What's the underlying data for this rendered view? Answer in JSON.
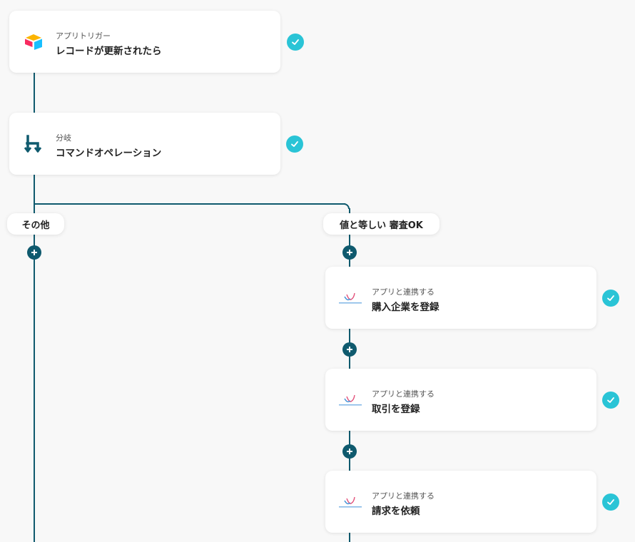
{
  "trigger": {
    "subtitle": "アプリトリガー",
    "title": "レコードが更新されたら",
    "icon": "airtable-logo-icon"
  },
  "branch_step": {
    "subtitle": "分岐",
    "title": "コマンドオペレーション",
    "icon": "branch-icon"
  },
  "branches": {
    "other_label": "その他",
    "match_label": "値と等しい 審査OK"
  },
  "actions": [
    {
      "subtitle": "アプリと連携する",
      "title": "購入企業を登録",
      "icon": "paid-app-logo-icon"
    },
    {
      "subtitle": "アプリと連携する",
      "title": "取引を登録",
      "icon": "paid-app-logo-icon"
    },
    {
      "subtitle": "アプリと連携する",
      "title": "請求を依頼",
      "icon": "paid-app-logo-icon"
    }
  ],
  "colors": {
    "connector": "#0f5a6e",
    "check": "#2ac4d6",
    "background": "#f8f8f8"
  }
}
